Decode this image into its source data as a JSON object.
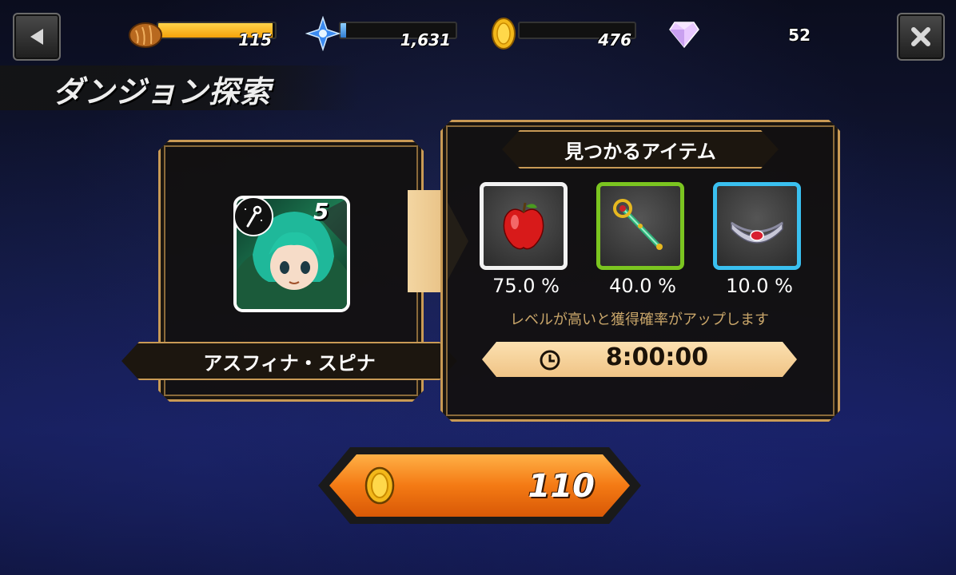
{
  "topbar": {
    "back_icon": "back-arrow-icon",
    "close_icon": "close-x-icon",
    "stamina": {
      "icon": "bread-icon",
      "value": "115",
      "fill_fraction": 0.98,
      "color": "#f5a20a"
    },
    "crystals": {
      "icon": "blue-crystal-icon",
      "value": "1,631",
      "fill_fraction": 0.05,
      "color": "#4aa0e8"
    },
    "coins": {
      "icon": "gold-coin-icon",
      "value": "476",
      "fill_fraction": 0.0,
      "color": "#f5c518"
    },
    "gems": {
      "icon": "diamond-icon",
      "value": "52"
    }
  },
  "title": "ダンジョン探索",
  "character": {
    "name": "アスフィナ・スピナ",
    "level_badge": "5",
    "class_icon": "staff-class-icon"
  },
  "items_panel": {
    "heading": "見つかるアイテム",
    "items": [
      {
        "icon": "apple-icon",
        "rate": "75.0 %",
        "frame_color": "#ffffff"
      },
      {
        "icon": "magic-staff-icon",
        "rate": "40.0 %",
        "frame_color": "#7bc520"
      },
      {
        "icon": "circlet-icon",
        "rate": "10.0 %",
        "frame_color": "#3ac0f0"
      }
    ],
    "hint": "レベルが高いと獲得確率がアップします"
  },
  "timer": {
    "icon": "clock-icon",
    "value": "8:00:00"
  },
  "cost_button": {
    "icon": "gold-coin-icon",
    "value": "110"
  }
}
